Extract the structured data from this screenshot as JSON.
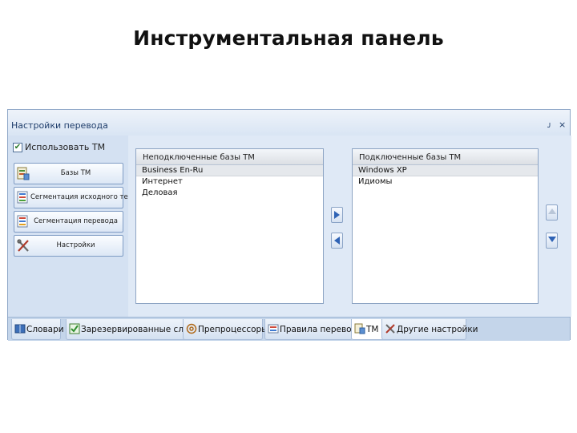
{
  "slide": {
    "title": "Инструментальная панель"
  },
  "panel": {
    "title": "Настройки перевода",
    "pin_glyph": "ᴊ",
    "close_glyph": "×",
    "use_tm": {
      "label": "Использовать TM",
      "checked": true,
      "check_glyph": "✔"
    },
    "nav_buttons": [
      {
        "label": "Базы TM",
        "icon": "database-icon"
      },
      {
        "label": "Сегментация исходного текста",
        "icon": "segmentation-icon"
      },
      {
        "label": "Сегментация перевода",
        "icon": "segmentation-icon"
      },
      {
        "label": "Настройки",
        "icon": "tools-icon"
      }
    ],
    "unconnected": {
      "header": "Неподключенные базы TM",
      "items": [
        "Business En-Ru",
        "Интернет",
        "Деловая"
      ],
      "selected_index": 0
    },
    "connected": {
      "header": "Подключенные базы TM",
      "items": [
        "Windows XP",
        "Идиомы"
      ],
      "selected_index": 0
    },
    "arrow_buttons": {
      "move_right": "arrow-right-icon",
      "move_left": "arrow-left-icon",
      "move_up": "arrow-up-icon",
      "move_down": "arrow-down-icon"
    },
    "tabs": [
      {
        "label": "Словари",
        "icon": "book-icon",
        "active": false
      },
      {
        "label": "Зарезервированные слова",
        "icon": "check-icon",
        "active": false
      },
      {
        "label": "Препроцессоры",
        "icon": "at-sign-icon",
        "active": false
      },
      {
        "label": "Правила перевода",
        "icon": "rules-icon",
        "active": false
      },
      {
        "label": "TM",
        "icon": "tm-icon",
        "active": true
      },
      {
        "label": "Другие настройки",
        "icon": "tools-icon",
        "active": false
      }
    ]
  },
  "colors": {
    "panel_bg": "#d6e3f3",
    "title_text": "#1f3d6b",
    "border": "#8fa8c8",
    "arrow_blue": "#2f63b5"
  }
}
